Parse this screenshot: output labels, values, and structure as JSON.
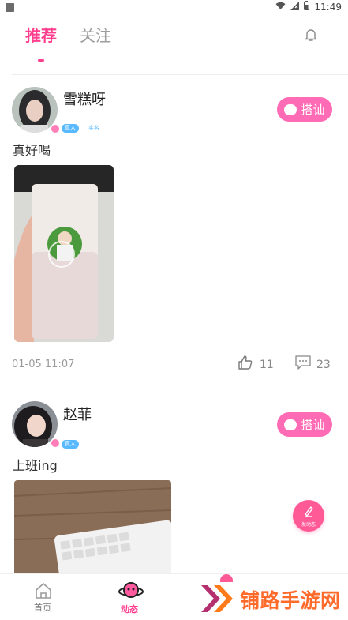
{
  "status": {
    "time": "11:49"
  },
  "tabs": [
    {
      "label": "推荐",
      "active": true
    },
    {
      "label": "关注",
      "active": false
    }
  ],
  "posts": [
    {
      "user": "雪糕呀",
      "badges": [
        "真人",
        "实名"
      ],
      "chat_label": "搭讪",
      "text": "真好喝",
      "timestamp": "01-05 11:07",
      "likes": "11",
      "comments": "23"
    },
    {
      "user": "赵菲",
      "badges": [
        "真人"
      ],
      "chat_label": "搭讪",
      "text": "上班ing"
    }
  ],
  "fab": {
    "label": "发动态"
  },
  "bottom_nav": [
    {
      "label": "首页",
      "icon": "home-icon",
      "active": false
    },
    {
      "label": "动态",
      "icon": "planet-icon",
      "active": true
    }
  ],
  "watermark": {
    "text": "铺路手游网"
  },
  "colors": {
    "accent": "#ff3e8d",
    "chat_button": "#ff6bb5",
    "badge": "#59b9ff"
  }
}
